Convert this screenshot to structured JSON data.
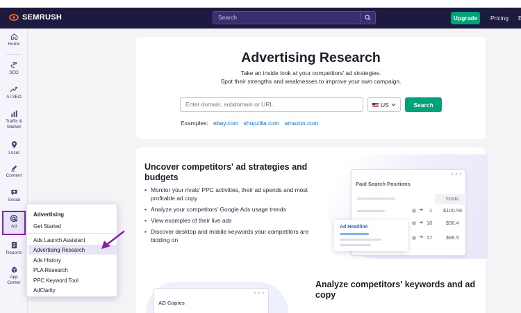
{
  "topbar": {
    "brand": "SEMRUSH",
    "search_placeholder": "Search",
    "upgrade_label": "Upgrade",
    "pricing_label": "Pricing",
    "more_label": "E"
  },
  "sidebar": {
    "items": [
      {
        "label": "Home",
        "icon": "home-icon"
      },
      {
        "label": "SEO",
        "icon": "seo-icon"
      },
      {
        "label": "AI SEO",
        "icon": "ai-sparkle-icon"
      },
      {
        "label": "Traffic &",
        "label2": "Market",
        "icon": "bar-chart-icon"
      },
      {
        "label": "Local",
        "icon": "location-pin-icon"
      },
      {
        "label": "Content",
        "icon": "pen-icon"
      },
      {
        "label": "Social",
        "icon": "heart-chat-icon"
      },
      {
        "label": "Ad",
        "icon": "target-cursor-icon"
      },
      {
        "label": "Reports",
        "icon": "report-icon"
      },
      {
        "label": "App",
        "label2": "Center",
        "icon": "app-center-icon"
      }
    ]
  },
  "flyout": {
    "title": "Advertising",
    "items": [
      "Get Started",
      "Ads Launch Assistant",
      "Advertising Research",
      "Ads History",
      "PLA Research",
      "PPC Keyword Tool",
      "AdClarity"
    ],
    "highlighted": "Advertising Research"
  },
  "hero": {
    "title": "Advertising Research",
    "subtitle1": "Take an inside look at your competitors' ad strategies.",
    "subtitle2": "Spot their strengths and weaknesses to improve your own campaign.",
    "input_placeholder": "Enter domain, subdomain or URL",
    "country": "US",
    "search_button": "Search",
    "examples_label": "Examples:",
    "examples": [
      "ebay.com",
      "shopzilla.com",
      "amazon.com"
    ]
  },
  "section1": {
    "heading": "Uncover competitors' ad strategies and budgets",
    "bullets": [
      "Monitor your rivals' PPC activities, their ad spends and most profitable ad copy",
      "Analyze your competitors' Google Ads usage trends",
      "View examples of their live ads",
      "Discover desktop and mobile keywords your competitors are bidding on"
    ]
  },
  "illustration": {
    "panel_title": "Paid Search Positions",
    "col_header": "Costs",
    "rows": [
      {
        "pos": "1",
        "cost": "$100.56"
      },
      {
        "pos": "10",
        "cost": "$98.4"
      },
      {
        "pos": "17",
        "cost": "$88.5"
      }
    ],
    "ad_card_label": "Ad Headline"
  },
  "section2": {
    "heading": "Analyze competitors' keywords and ad copy",
    "panel_title": "AD Copies"
  },
  "colors": {
    "topbar": "#1c1b3f",
    "accent_green": "#00a27a",
    "highlight_border": "#8a1fa8",
    "link": "#0a6fd6"
  }
}
